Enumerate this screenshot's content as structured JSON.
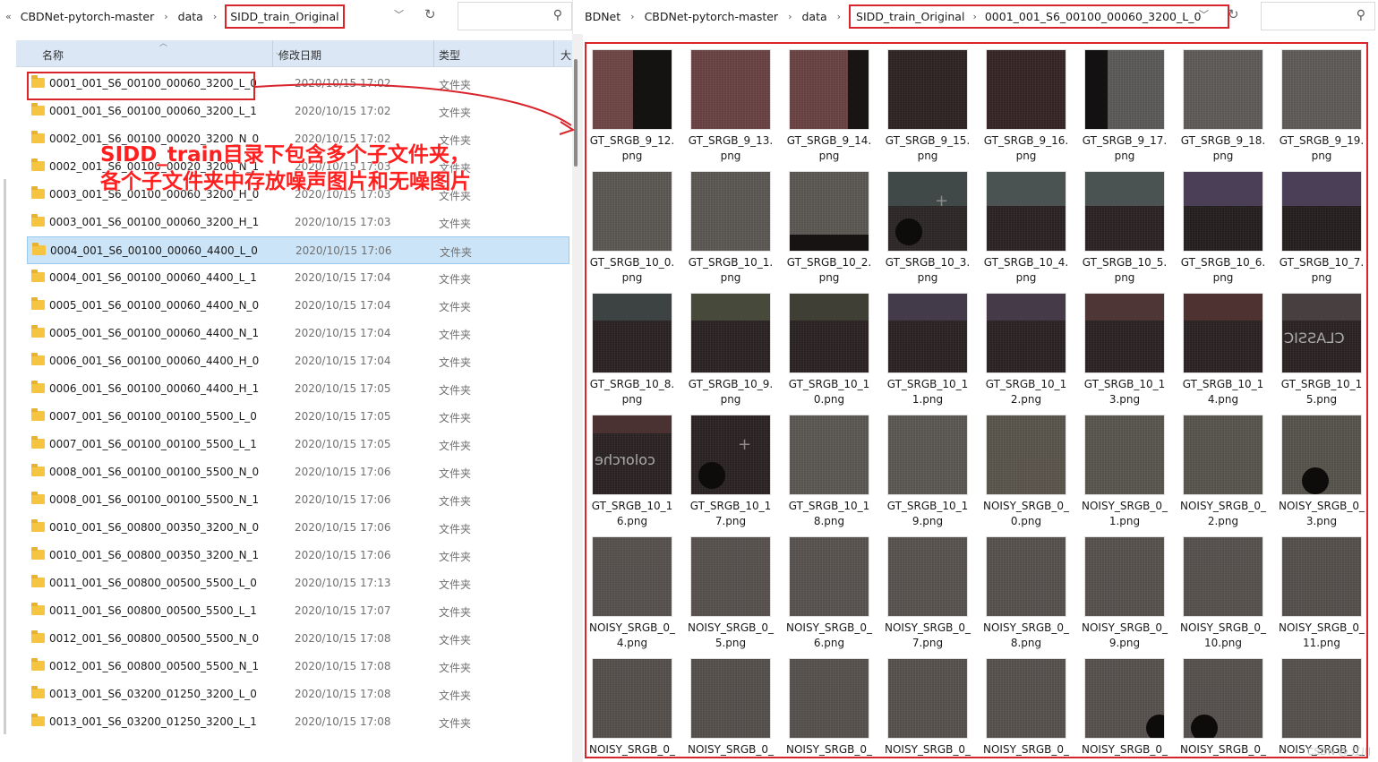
{
  "left": {
    "breadcrumb": [
      "«",
      "CBDNet-pytorch-master",
      "data",
      "SIDD_train_Original"
    ],
    "columns": [
      "名称",
      "修改日期",
      "类型",
      "大"
    ],
    "files": [
      {
        "name": "0001_001_S6_00100_00060_3200_L_0",
        "date": "2020/10/15 17:02",
        "type": "文件夹"
      },
      {
        "name": "0001_001_S6_00100_00060_3200_L_1",
        "date": "2020/10/15 17:02",
        "type": "文件夹"
      },
      {
        "name": "0002_001_S6_00100_00020_3200_N_0",
        "date": "2020/10/15 17:02",
        "type": "文件夹"
      },
      {
        "name": "0002_001_S6_00100_00020_3200_N_1",
        "date": "2020/10/15 17:03",
        "type": "文件夹"
      },
      {
        "name": "0003_001_S6_00100_00060_3200_H_0",
        "date": "2020/10/15 17:03",
        "type": "文件夹"
      },
      {
        "name": "0003_001_S6_00100_00060_3200_H_1",
        "date": "2020/10/15 17:03",
        "type": "文件夹"
      },
      {
        "name": "0004_001_S6_00100_00060_4400_L_0",
        "date": "2020/10/15 17:06",
        "type": "文件夹"
      },
      {
        "name": "0004_001_S6_00100_00060_4400_L_1",
        "date": "2020/10/15 17:04",
        "type": "文件夹"
      },
      {
        "name": "0005_001_S6_00100_00060_4400_N_0",
        "date": "2020/10/15 17:04",
        "type": "文件夹"
      },
      {
        "name": "0005_001_S6_00100_00060_4400_N_1",
        "date": "2020/10/15 17:04",
        "type": "文件夹"
      },
      {
        "name": "0006_001_S6_00100_00060_4400_H_0",
        "date": "2020/10/15 17:04",
        "type": "文件夹"
      },
      {
        "name": "0006_001_S6_00100_00060_4400_H_1",
        "date": "2020/10/15 17:05",
        "type": "文件夹"
      },
      {
        "name": "0007_001_S6_00100_00100_5500_L_0",
        "date": "2020/10/15 17:05",
        "type": "文件夹"
      },
      {
        "name": "0007_001_S6_00100_00100_5500_L_1",
        "date": "2020/10/15 17:05",
        "type": "文件夹"
      },
      {
        "name": "0008_001_S6_00100_00100_5500_N_0",
        "date": "2020/10/15 17:06",
        "type": "文件夹"
      },
      {
        "name": "0008_001_S6_00100_00100_5500_N_1",
        "date": "2020/10/15 17:06",
        "type": "文件夹"
      },
      {
        "name": "0010_001_S6_00800_00350_3200_N_0",
        "date": "2020/10/15 17:06",
        "type": "文件夹"
      },
      {
        "name": "0010_001_S6_00800_00350_3200_N_1",
        "date": "2020/10/15 17:06",
        "type": "文件夹"
      },
      {
        "name": "0011_001_S6_00800_00500_5500_L_0",
        "date": "2020/10/15 17:13",
        "type": "文件夹"
      },
      {
        "name": "0011_001_S6_00800_00500_5500_L_1",
        "date": "2020/10/15 17:07",
        "type": "文件夹"
      },
      {
        "name": "0012_001_S6_00800_00500_5500_N_0",
        "date": "2020/10/15 17:08",
        "type": "文件夹"
      },
      {
        "name": "0012_001_S6_00800_00500_5500_N_1",
        "date": "2020/10/15 17:08",
        "type": "文件夹"
      },
      {
        "name": "0013_001_S6_03200_01250_3200_L_0",
        "date": "2020/10/15 17:08",
        "type": "文件夹"
      },
      {
        "name": "0013_001_S6_03200_01250_3200_L_1",
        "date": "2020/10/15 17:08",
        "type": "文件夹"
      }
    ],
    "annotation": [
      "SIDD_train目录下包含多个子文件夹，",
      "各个子文件夹中存放噪声图片和无噪图片"
    ]
  },
  "right": {
    "breadcrumb": [
      "BDNet",
      "CBDNet-pytorch-master",
      "data",
      "SIDD_train_Original",
      "0001_001_S6_00100_00060_3200_L_0"
    ],
    "thumbnails": [
      {
        "caption": "GT_SRGB_9_12.png",
        "color": "#6e4545",
        "alt": "#151212"
      },
      {
        "caption": "GT_SRGB_9_13.png",
        "color": "#6a4242"
      },
      {
        "caption": "GT_SRGB_9_14.png",
        "color": "#6a4242",
        "alt": "#1a1515"
      },
      {
        "caption": "GT_SRGB_9_15.png",
        "color": "#2e2222"
      },
      {
        "caption": "GT_SRGB_9_16.png",
        "color": "#362424"
      },
      {
        "caption": "GT_SRGB_9_17.png",
        "color": "#5c5a58",
        "alt": "#131111"
      },
      {
        "caption": "GT_SRGB_9_18.png",
        "color": "#5e5b58"
      },
      {
        "caption": "GT_SRGB_9_19.png",
        "color": "#5e5b58"
      },
      {
        "caption": "GT_SRGB_10_0.png",
        "color": "#5b5854"
      },
      {
        "caption": "GT_SRGB_10_1.png",
        "color": "#5b5854"
      },
      {
        "caption": "GT_SRGB_10_2.png",
        "color": "#5b5854",
        "alt": "#171313"
      },
      {
        "caption": "GT_SRGB_10_3.png",
        "color": "#2c2626",
        "alt": "#404848"
      },
      {
        "caption": "GT_SRGB_10_4.png",
        "color": "#2a2222",
        "alt": "#4a5252"
      },
      {
        "caption": "GT_SRGB_10_5.png",
        "color": "#2a2222",
        "alt": "#4a5252"
      },
      {
        "caption": "GT_SRGB_10_6.png",
        "color": "#241e1e",
        "alt": "#4b3e57"
      },
      {
        "caption": "GT_SRGB_10_7.png",
        "color": "#241e1e",
        "alt": "#4b3e57"
      },
      {
        "caption": "GT_SRGB_10_8.png",
        "color": "#2a2222",
        "alt": "#3d4242"
      },
      {
        "caption": "GT_SRGB_10_9.png",
        "color": "#2a2222",
        "alt": "#474a3a"
      },
      {
        "caption": "GT_SRGB_10_10.png",
        "color": "#2a2222",
        "alt": "#3f3f36"
      },
      {
        "caption": "GT_SRGB_10_11.png",
        "color": "#2a2222",
        "alt": "#433a4a"
      },
      {
        "caption": "GT_SRGB_10_12.png",
        "color": "#2a2222",
        "alt": "#443a48"
      },
      {
        "caption": "GT_SRGB_10_13.png",
        "color": "#2a2222",
        "alt": "#4e3636"
      },
      {
        "caption": "GT_SRGB_10_14.png",
        "color": "#2a2222",
        "alt": "#4e3232"
      },
      {
        "caption": "GT_SRGB_10_15.png",
        "color": "#2a2222",
        "alt": "#484040"
      },
      {
        "caption": "GT_SRGB_10_16.png",
        "color": "#2a2222",
        "alt": "#4a3232"
      },
      {
        "caption": "GT_SRGB_10_17.png",
        "color": "#2a2222"
      },
      {
        "caption": "GT_SRGB_10_18.png",
        "color": "#5b5854"
      },
      {
        "caption": "GT_SRGB_10_19.png",
        "color": "#5b5854"
      },
      {
        "caption": "NOISY_SRGB_0_0.png",
        "color": "#5a554b"
      },
      {
        "caption": "NOISY_SRGB_0_1.png",
        "color": "#59564e"
      },
      {
        "caption": "NOISY_SRGB_0_2.png",
        "color": "#58554d"
      },
      {
        "caption": "NOISY_SRGB_0_3.png",
        "color": "#57544c"
      },
      {
        "caption": "NOISY_SRGB_0_4.png",
        "color": "#57514e"
      },
      {
        "caption": "NOISY_SRGB_0_5.png",
        "color": "#57514e"
      },
      {
        "caption": "NOISY_SRGB_0_6.png",
        "color": "#58534f"
      },
      {
        "caption": "NOISY_SRGB_0_7.png",
        "color": "#58534f"
      },
      {
        "caption": "NOISY_SRGB_0_8.png",
        "color": "#57524e"
      },
      {
        "caption": "NOISY_SRGB_0_9.png",
        "color": "#57524e"
      },
      {
        "caption": "NOISY_SRGB_0_10.png",
        "color": "#56514d"
      },
      {
        "caption": "NOISY_SRGB_0_11.png",
        "color": "#55504c"
      },
      {
        "caption": "NOISY_SRGB_0_",
        "color": "#55504c"
      },
      {
        "caption": "NOISY_SRGB_0_",
        "color": "#55504c"
      },
      {
        "caption": "NOISY_SRGB_0_",
        "color": "#56514d"
      },
      {
        "caption": "NOISY_SRGB_0_",
        "color": "#57524e"
      },
      {
        "caption": "NOISY_SRGB_0_",
        "color": "#57524e"
      },
      {
        "caption": "NOISY_SRGB_0_",
        "color": "#57524e"
      },
      {
        "caption": "NOISY_SRGB_0_",
        "color": "#56514d"
      },
      {
        "caption": "NOISY_SRGB_0_",
        "color": "#56514d"
      }
    ],
    "watermark": "CSDN @ 江川"
  },
  "colors": {
    "annotation_red": "#d8242b",
    "selection": "#cce4f7",
    "header_bg": "#dbe7f5"
  }
}
